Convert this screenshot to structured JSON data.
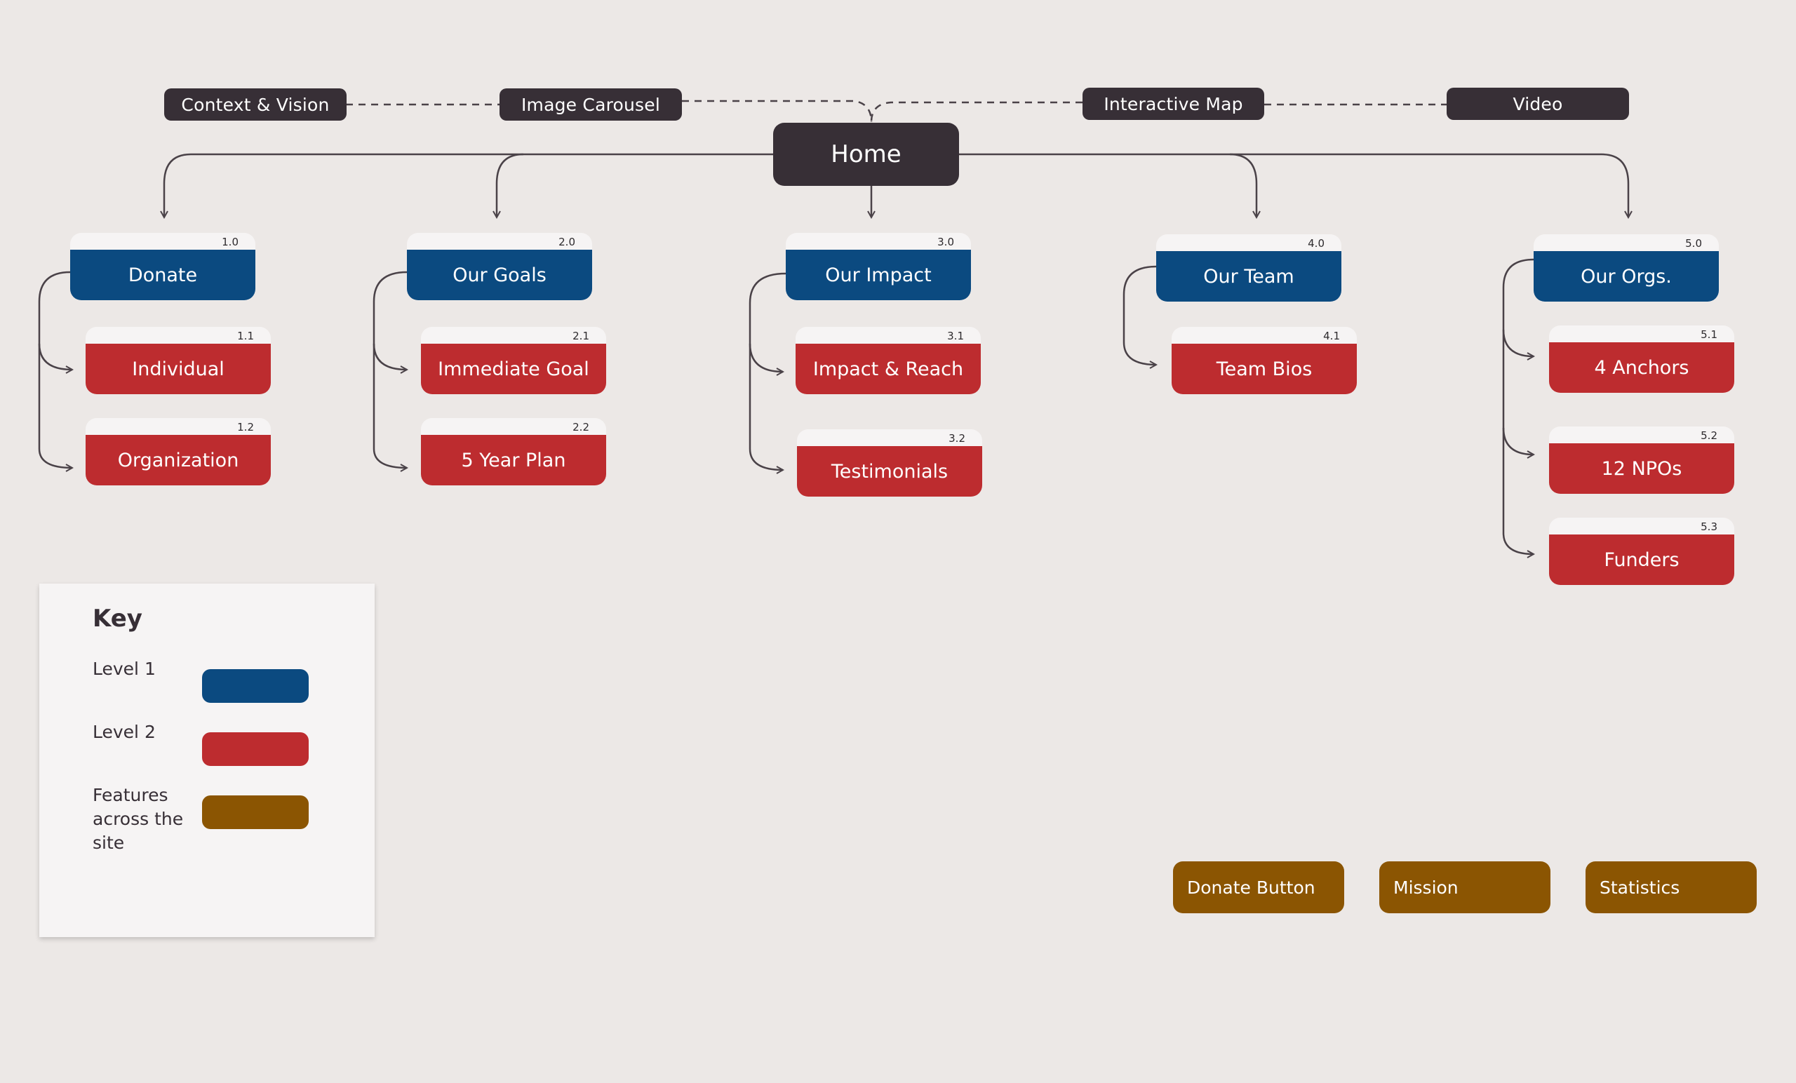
{
  "colors": {
    "background": "#ece8e6",
    "level1": "#0b4a80",
    "level2": "#bd2c2f",
    "feature": "#8b5502",
    "dark": "#372f36",
    "card_header": "#f6f4f4"
  },
  "home": {
    "label": "Home"
  },
  "top_features": [
    {
      "label": "Context & Vision"
    },
    {
      "label": "Image Carousel"
    },
    {
      "label": "Interactive Map"
    },
    {
      "label": "Video"
    }
  ],
  "sections": [
    {
      "num": "1.0",
      "label": "Donate",
      "children": [
        {
          "num": "1.1",
          "label": "Individual"
        },
        {
          "num": "1.2",
          "label": "Organization"
        }
      ]
    },
    {
      "num": "2.0",
      "label": "Our Goals",
      "children": [
        {
          "num": "2.1",
          "label": "Immediate Goal"
        },
        {
          "num": "2.2",
          "label": "5 Year Plan"
        }
      ]
    },
    {
      "num": "3.0",
      "label": "Our Impact",
      "children": [
        {
          "num": "3.1",
          "label": "Impact & Reach"
        },
        {
          "num": "3.2",
          "label": "Testimonials"
        }
      ]
    },
    {
      "num": "4.0",
      "label": "Our Team",
      "children": [
        {
          "num": "4.1",
          "label": "Team Bios"
        }
      ]
    },
    {
      "num": "5.0",
      "label": "Our Orgs.",
      "children": [
        {
          "num": "5.1",
          "label": "4 Anchors"
        },
        {
          "num": "5.2",
          "label": "12 NPOs"
        },
        {
          "num": "5.3",
          "label": "Funders"
        }
      ]
    }
  ],
  "key": {
    "title": "Key",
    "items": [
      {
        "label": "Level 1"
      },
      {
        "label": "Level 2"
      },
      {
        "label": "Features across the site"
      }
    ]
  },
  "site_features": [
    {
      "label": "Donate Button"
    },
    {
      "label": "Mission"
    },
    {
      "label": "Statistics"
    }
  ]
}
